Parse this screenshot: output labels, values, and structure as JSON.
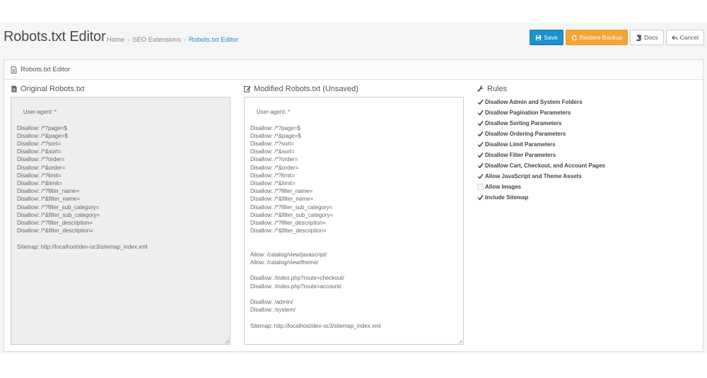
{
  "header": {
    "title": "Robots.txt Editor",
    "breadcrumb": [
      "Home",
      "SEO Extensions",
      "Robots.txt Editor"
    ]
  },
  "toolbar": {
    "save_label": "Save",
    "restore_label": "Restore Backup",
    "docs_label": "Docs",
    "cancel_label": "Cancel"
  },
  "panel": {
    "heading": "Robots.txt Editor"
  },
  "original": {
    "title": "Original Robots.txt",
    "content": "User-agent: *\n\nDisallow: /*?page=$\nDisallow: /*&page=$\nDisallow: /*?sort=\nDisallow: /*&sort=\nDisallow: /*?order=\nDisallow: /*&order=\nDisallow: /*?limit=\nDisallow: /*&limit=\nDisallow: /*?filter_name=\nDisallow: /*&filter_name=\nDisallow: /*?filter_sub_category=\nDisallow: /*&filter_sub_category=\nDisallow: /*?filter_description=\nDisallow: /*&filter_description=\n\nSitemap: http://localhost/dev-oc3/sitemap_index.xml"
  },
  "modified": {
    "title": "Modified Robots.txt (Unsaved)",
    "content": "User-agent: *\n\nDisallow: /*?page=$\nDisallow: /*&page=$\nDisallow: /*?sort=\nDisallow: /*&sort=\nDisallow: /*?order=\nDisallow: /*&order=\nDisallow: /*?limit=\nDisallow: /*&limit=\nDisallow: /*?filter_name=\nDisallow: /*&filter_name=\nDisallow: /*?filter_sub_category=\nDisallow: /*&filter_sub_category=\nDisallow: /*?filter_description=\nDisallow: /*&filter_description=\n\n\nAllow: /catalog/view/javascript/\nAllow: /catalog/view/theme/\n\nDisallow: /index.php?route=checkout/\nDisallow: /index.php?route=account/\n\nDisallow: /admin/\nDisallow: /system/\n\nSitemap: http://localhost/dev-oc3/sitemap_index.xml"
  },
  "rules": {
    "title": "Rules",
    "items": [
      {
        "label": "Disallow Admin and System Folders",
        "checked": true
      },
      {
        "label": "Disallow Pagination Parameters",
        "checked": true
      },
      {
        "label": "Disallow Sorting Parameters",
        "checked": true
      },
      {
        "label": "Disallow Ordering Parameters",
        "checked": true
      },
      {
        "label": "Disallow Limit Parameters",
        "checked": true
      },
      {
        "label": "Disallow Filter Parameters",
        "checked": true
      },
      {
        "label": "Disallow Cart, Checkout, and Account Pages",
        "checked": true
      },
      {
        "label": "Allow JavaScript and Theme Assets",
        "checked": true
      },
      {
        "label": "Allow Images",
        "checked": false
      },
      {
        "label": "Include Sitemap",
        "checked": true
      }
    ]
  },
  "colors": {
    "primary": "#1e91cf",
    "warning": "#f3a638"
  }
}
